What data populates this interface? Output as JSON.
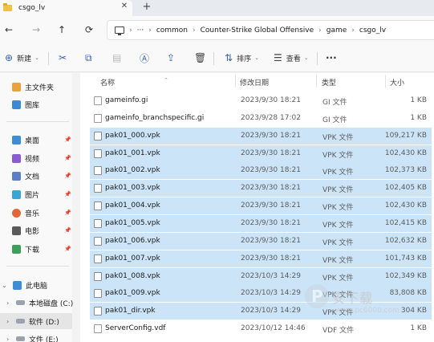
{
  "tabbar": {
    "tab_title": "csgo_lv",
    "close_glyph": "✕",
    "new_tab_glyph": "+"
  },
  "nav": {
    "back_glyph": "←",
    "forward_glyph": "→",
    "up_glyph": "↑",
    "refresh_glyph": "⟳",
    "more_glyph": "···",
    "breadcrumbs": [
      "common",
      "Counter-Strike Global Offensive",
      "game",
      "csgo_lv"
    ]
  },
  "commands": {
    "new_label": "新建",
    "sort_label": "排序",
    "view_label": "查看",
    "more_glyph": "···"
  },
  "sidebar": {
    "quick": [
      {
        "label": "主文件夹",
        "icon": "home-icon"
      },
      {
        "label": "图库",
        "icon": "gallery-icon"
      }
    ],
    "pinned": [
      {
        "label": "桌面",
        "icon": "desktop-icon",
        "color": "#3b8fd8"
      },
      {
        "label": "视频",
        "icon": "video-icon",
        "color": "#8a5cd0"
      },
      {
        "label": "文档",
        "icon": "documents-icon",
        "color": "#5b7ec7"
      },
      {
        "label": "图片",
        "icon": "pictures-icon",
        "color": "#3aa6d6"
      },
      {
        "label": "音乐",
        "icon": "music-icon",
        "color": "#e0663c"
      },
      {
        "label": "电影",
        "icon": "movies-icon",
        "color": "#5a5a5a"
      },
      {
        "label": "下载",
        "icon": "downloads-icon",
        "color": "#3aa05a"
      }
    ],
    "this_pc_label": "此电脑",
    "drives": [
      {
        "label": "本地磁盘 (C:)"
      },
      {
        "label": "软件 (D:)"
      },
      {
        "label": "文件 (E:)"
      }
    ]
  },
  "list": {
    "columns": {
      "name": "名称",
      "date": "修改日期",
      "type": "类型",
      "size": "大小"
    },
    "rows": [
      {
        "name": "gameinfo.gi",
        "date": "2023/9/30 18:21",
        "type": "GI 文件",
        "size": "1 KB",
        "selected": false
      },
      {
        "name": "gameinfo_branchspecific.gi",
        "date": "2023/9/28 17:02",
        "type": "GI 文件",
        "size": "1 KB",
        "selected": false
      },
      {
        "name": "pak01_000.vpk",
        "date": "2023/9/30 18:21",
        "type": "VPK 文件",
        "size": "109,217 KB",
        "selected": true
      },
      {
        "name": "pak01_001.vpk",
        "date": "2023/9/30 18:21",
        "type": "VPK 文件",
        "size": "102,430 KB",
        "selected": true
      },
      {
        "name": "pak01_002.vpk",
        "date": "2023/9/30 18:21",
        "type": "VPK 文件",
        "size": "102,373 KB",
        "selected": true
      },
      {
        "name": "pak01_003.vpk",
        "date": "2023/9/30 18:21",
        "type": "VPK 文件",
        "size": "102,405 KB",
        "selected": true
      },
      {
        "name": "pak01_004.vpk",
        "date": "2023/9/30 18:21",
        "type": "VPK 文件",
        "size": "102,430 KB",
        "selected": true
      },
      {
        "name": "pak01_005.vpk",
        "date": "2023/9/30 18:21",
        "type": "VPK 文件",
        "size": "102,415 KB",
        "selected": true
      },
      {
        "name": "pak01_006.vpk",
        "date": "2023/9/30 18:21",
        "type": "VPK 文件",
        "size": "102,632 KB",
        "selected": true
      },
      {
        "name": "pak01_007.vpk",
        "date": "2023/9/30 18:21",
        "type": "VPK 文件",
        "size": "101,743 KB",
        "selected": true
      },
      {
        "name": "pak01_008.vpk",
        "date": "2023/10/3 14:29",
        "type": "VPK 文件",
        "size": "102,349 KB",
        "selected": true
      },
      {
        "name": "pak01_009.vpk",
        "date": "2023/10/3 14:29",
        "type": "VPK 文件",
        "size": "83,808 KB",
        "selected": true
      },
      {
        "name": "pak01_dir.vpk",
        "date": "2023/10/3 14:29",
        "type": "VPK 文件",
        "size": "304 KB",
        "selected": true
      },
      {
        "name": "ServerConfig.vdf",
        "date": "2023/10/12 14:46",
        "type": "VDF 文件",
        "size": "1 KB",
        "selected": false
      }
    ]
  },
  "watermark": {
    "line1": "安下载",
    "line2": "www.pc6000.com"
  },
  "colors": {
    "selection": "#cce4f7",
    "accent": "#3a63a8"
  }
}
